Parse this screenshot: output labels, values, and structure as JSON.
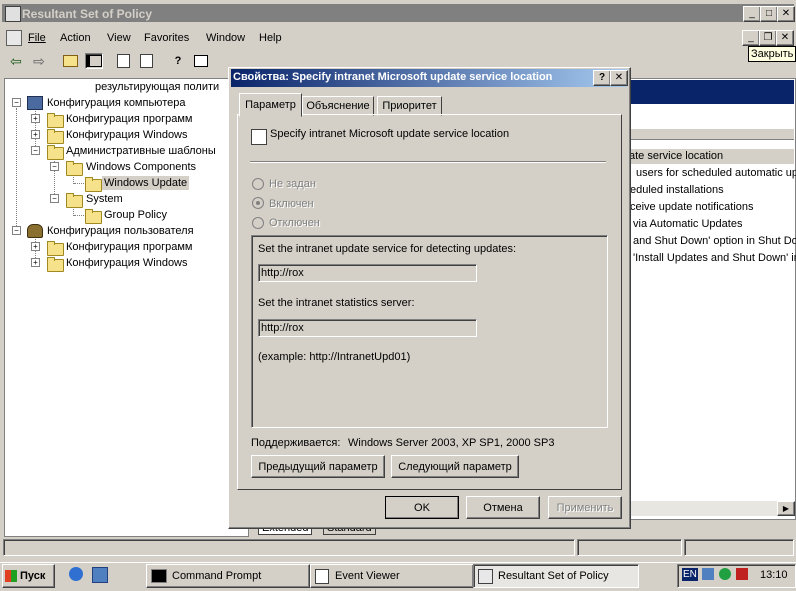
{
  "window": {
    "title": "Resultant Set of Policy",
    "close_tooltip": "Закрыть"
  },
  "menu": [
    "File",
    "Action",
    "View",
    "Favorites",
    "Window",
    "Help"
  ],
  "tree": {
    "root_label": "результирующая полити",
    "items": [
      {
        "label": "Конфигурация компьютера"
      },
      {
        "label": "Конфигурация программ"
      },
      {
        "label": "Конфигурация Windows"
      },
      {
        "label": "Административные шаблоны"
      },
      {
        "label": "Windows Components"
      },
      {
        "label": "Windows Update"
      },
      {
        "label": "System"
      },
      {
        "label": "Group Policy"
      },
      {
        "label": "Конфигурация пользователя"
      },
      {
        "label": "Конфигурация программ"
      },
      {
        "label": "Конфигурация Windows"
      }
    ]
  },
  "right_list": {
    "items": [
      "ate service location",
      "users for scheduled automatic up",
      "eduled installations",
      "ceive update notifications",
      "via Automatic Updates",
      "and Shut Down' option in Shut Do",
      "'Install Updates and Shut Down' in"
    ],
    "tabs": [
      "Extended",
      "Standard"
    ]
  },
  "dialog": {
    "title": "Свойства: Specify intranet Microsoft update service location",
    "tabs": [
      "Параметр",
      "Объяснение",
      "Приоритет"
    ],
    "policy_name": "Specify intranet Microsoft update service location",
    "radios": [
      {
        "label": "Не задан",
        "selected": false
      },
      {
        "label": "Включен",
        "selected": true
      },
      {
        "label": "Отключен",
        "selected": false
      }
    ],
    "detect_label": "Set the intranet update service for detecting updates:",
    "detect_value": "http://rox",
    "stats_label": "Set the intranet statistics server:",
    "stats_value": "http://rox",
    "example": "(example: http://IntranetUpd01)",
    "supported_label": "Поддерживается:",
    "supported_value": "Windows Server 2003, XP SP1, 2000 SP3",
    "prev_button": "Предыдущий параметр",
    "next_button": "Следующий параметр",
    "ok_button": "OK",
    "cancel_button": "Отмена",
    "apply_button": "Применить"
  },
  "taskbar": {
    "start": "Пуск",
    "tasks": [
      "Command Prompt",
      "Event Viewer",
      "Resultant Set of Policy"
    ],
    "lang": "EN",
    "clock": "13:10"
  }
}
